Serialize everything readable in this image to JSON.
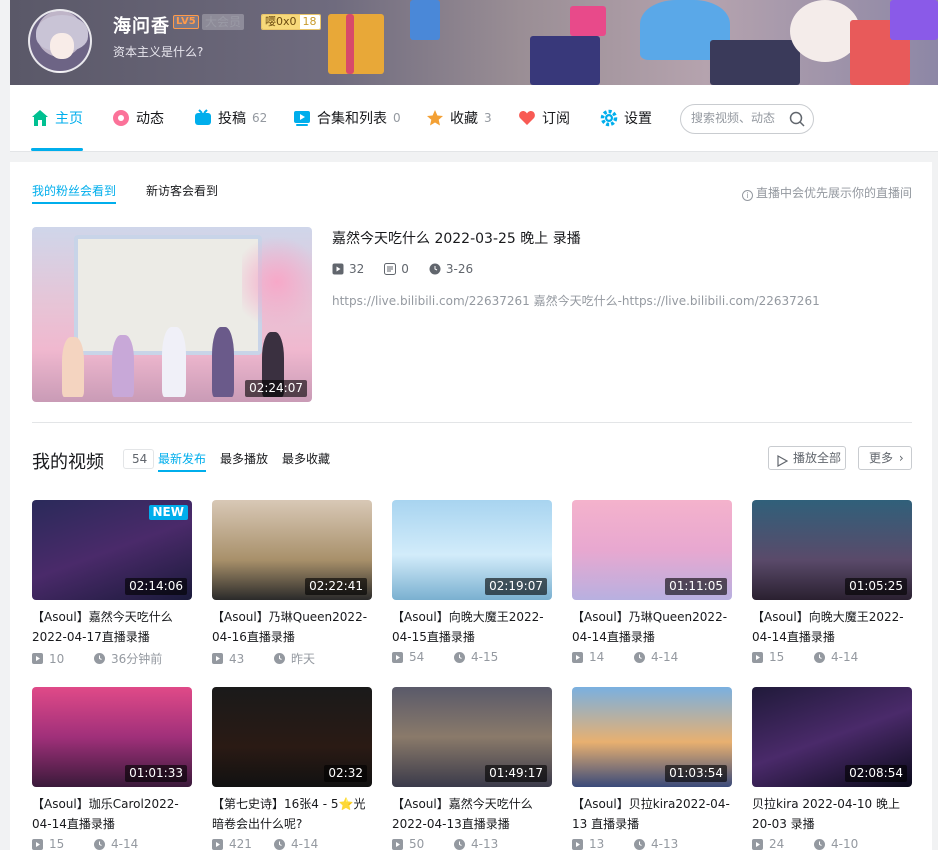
{
  "profile": {
    "username": "海问香",
    "level": "LV5",
    "vip": "大会员",
    "medal_name": "嘤0x0",
    "medal_level": "18",
    "sign": "资本主义是什么?"
  },
  "nav": {
    "items": [
      {
        "label": "主页",
        "count": ""
      },
      {
        "label": "动态",
        "count": ""
      },
      {
        "label": "投稿",
        "count": "62"
      },
      {
        "label": "合集和列表",
        "count": "0"
      },
      {
        "label": "收藏",
        "count": "3"
      },
      {
        "label": "订阅",
        "count": ""
      },
      {
        "label": "设置",
        "count": ""
      }
    ],
    "search_placeholder": "搜索视频、动态"
  },
  "pinned": {
    "tabs": [
      "我的粉丝会看到",
      "新访客会看到"
    ],
    "hint": "直播中会优先展示你的直播间",
    "title": "嘉然今天吃什么 2022-03-25 晚上 录播",
    "duration": "02:24:07",
    "plays": "32",
    "danmaku": "0",
    "date": "3-26",
    "desc": "https://live.bilibili.com/22637261 嘉然今天吃什么-https://live.bilibili.com/22637261"
  },
  "videos_section": {
    "title": "我的视频",
    "count": "54",
    "tabs": [
      "最新发布",
      "最多播放",
      "最多收藏"
    ],
    "play_all": "播放全部",
    "more": "更多"
  },
  "videos": [
    {
      "title": "【Asoul】嘉然今天吃什么2022-04-17直播录播",
      "duration": "02:14:06",
      "plays": "10",
      "date": "36分钟前",
      "tag": "NEW"
    },
    {
      "title": "【Asoul】乃琳Queen2022-04-16直播录播",
      "duration": "02:22:41",
      "plays": "43",
      "date": "昨天",
      "tag": ""
    },
    {
      "title": "【Asoul】向晚大魔王2022-04-15直播录播",
      "duration": "02:19:07",
      "plays": "54",
      "date": "4-15",
      "tag": ""
    },
    {
      "title": "【Asoul】乃琳Queen2022-04-14直播录播",
      "duration": "01:11:05",
      "plays": "14",
      "date": "4-14",
      "tag": ""
    },
    {
      "title": "【Asoul】向晚大魔王2022-04-14直播录播",
      "duration": "01:05:25",
      "plays": "15",
      "date": "4-14",
      "tag": ""
    },
    {
      "title": "【Asoul】珈乐Carol2022-04-14直播录播",
      "duration": "01:01:33",
      "plays": "15",
      "date": "4-14",
      "tag": ""
    },
    {
      "title": "【第七史诗】16张4 - 5⭐光暗卷会出什么呢?",
      "duration": "02:32",
      "plays": "421",
      "date": "4-14",
      "tag": ""
    },
    {
      "title": "【Asoul】嘉然今天吃什么2022-04-13直播录播",
      "duration": "01:49:17",
      "plays": "50",
      "date": "4-13",
      "tag": ""
    },
    {
      "title": "【Asoul】贝拉kira2022-04-13 直播录播",
      "duration": "01:03:54",
      "plays": "13",
      "date": "4-13",
      "tag": ""
    },
    {
      "title": "贝拉kira 2022-04-10 晚上 20-03 录播",
      "duration": "02:08:54",
      "plays": "24",
      "date": "4-10",
      "tag": ""
    }
  ],
  "colors": {
    "accent": "#00aeec",
    "text": "#18191c",
    "muted": "#9499a0"
  }
}
